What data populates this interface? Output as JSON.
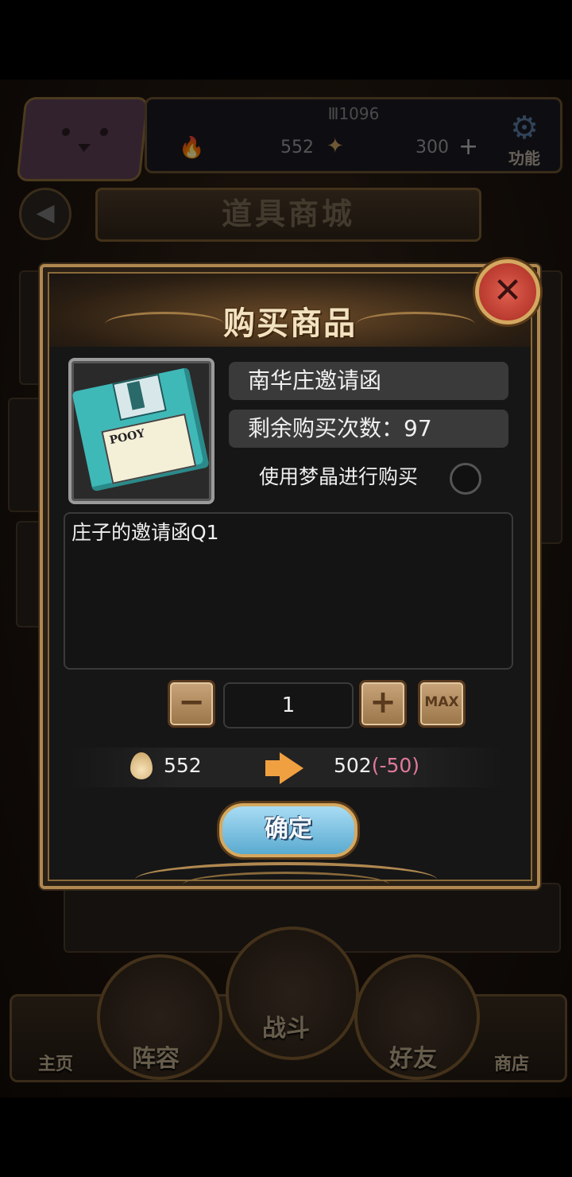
{
  "status": {
    "player_id": "Ⅲ1096",
    "currency_a": "552",
    "currency_b": "300",
    "function_label": "功能"
  },
  "shop": {
    "title": "道具商城"
  },
  "dialog": {
    "title": "购买商品",
    "item_name": "南华庄邀请函",
    "remaining_label": "剩余购买次数：97",
    "dream_crystal_label": "使用梦晶进行购买",
    "description": "庄子的邀请函Q1",
    "quantity": "1",
    "max_label": "MAX",
    "cost_current": "552",
    "cost_after": "502",
    "cost_delta": "(-50)",
    "confirm_label": "确定",
    "floppy_text": "POOY"
  },
  "nav": {
    "home": "主页",
    "lineup": "阵容",
    "battle": "战斗",
    "friends": "好友",
    "store": "商店"
  },
  "colors": {
    "frame_gold": "#b08850",
    "confirm_blue": "#5aaad0",
    "close_red": "#a82a20",
    "delta_pink": "#e07a9a",
    "arrow_orange": "#f0a040"
  }
}
